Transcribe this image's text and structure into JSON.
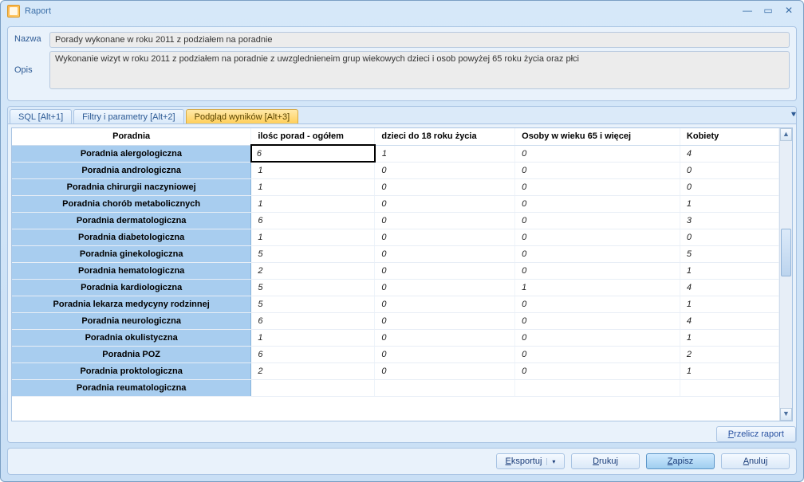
{
  "window": {
    "title": "Raport"
  },
  "info": {
    "name_label": "Nazwa",
    "name_value": "Porady wykonane w roku 2011 z podziałem na poradnie",
    "desc_label": "Opis",
    "desc_value": "Wykonanie wizyt w roku 2011 z podziałem na poradnie z uwzglednieneim grup wiekowych dzieci i osob powyżej 65 roku życia oraz płci"
  },
  "tabs": [
    {
      "label": "SQL [Alt+1]"
    },
    {
      "label": "Filtry i parametry [Alt+2]"
    },
    {
      "label": "Podgląd wyników [Alt+3]"
    }
  ],
  "table": {
    "columns": [
      "Poradnia",
      "ilośc porad - ogółem",
      "dzieci do 18 roku życia",
      "Osoby w wieku 65 i więcej",
      "Kobiety"
    ],
    "selected_cell": [
      0,
      1
    ],
    "rows": [
      [
        "Poradnia alergologiczna",
        "6",
        "1",
        "0",
        "4"
      ],
      [
        "Poradnia andrologiczna",
        "1",
        "0",
        "0",
        "0"
      ],
      [
        "Poradnia chirurgii naczyniowej",
        "1",
        "0",
        "0",
        "0"
      ],
      [
        "Poradnia chorób metabolicznych",
        "1",
        "0",
        "0",
        "1"
      ],
      [
        "Poradnia dermatologiczna",
        "6",
        "0",
        "0",
        "3"
      ],
      [
        "Poradnia diabetologiczna",
        "1",
        "0",
        "0",
        "0"
      ],
      [
        "Poradnia ginekologiczna",
        "5",
        "0",
        "0",
        "5"
      ],
      [
        "Poradnia hematologiczna",
        "2",
        "0",
        "0",
        "1"
      ],
      [
        "Poradnia kardiologiczna",
        "5",
        "0",
        "1",
        "4"
      ],
      [
        "Poradnia lekarza medycyny rodzinnej",
        "5",
        "0",
        "0",
        "1"
      ],
      [
        "Poradnia neurologiczna",
        "6",
        "0",
        "0",
        "4"
      ],
      [
        "Poradnia okulistyczna",
        "1",
        "0",
        "0",
        "1"
      ],
      [
        "Poradnia POZ",
        "6",
        "0",
        "0",
        "2"
      ],
      [
        "Poradnia proktologiczna",
        "2",
        "0",
        "0",
        "1"
      ],
      [
        "Poradnia reumatologiczna",
        "",
        "",
        "",
        ""
      ]
    ]
  },
  "buttons": {
    "przelicz_ul": "P",
    "przelicz_rest": "rzelicz raport",
    "eksportuj_ul": "E",
    "eksportuj_rest": "ksportuj",
    "drukuj_ul": "D",
    "drukuj_rest": "rukuj",
    "zapisz_ul": "Z",
    "zapisz_rest": "apisz",
    "anuluj_ul": "A",
    "anuluj_rest": "nuluj"
  }
}
